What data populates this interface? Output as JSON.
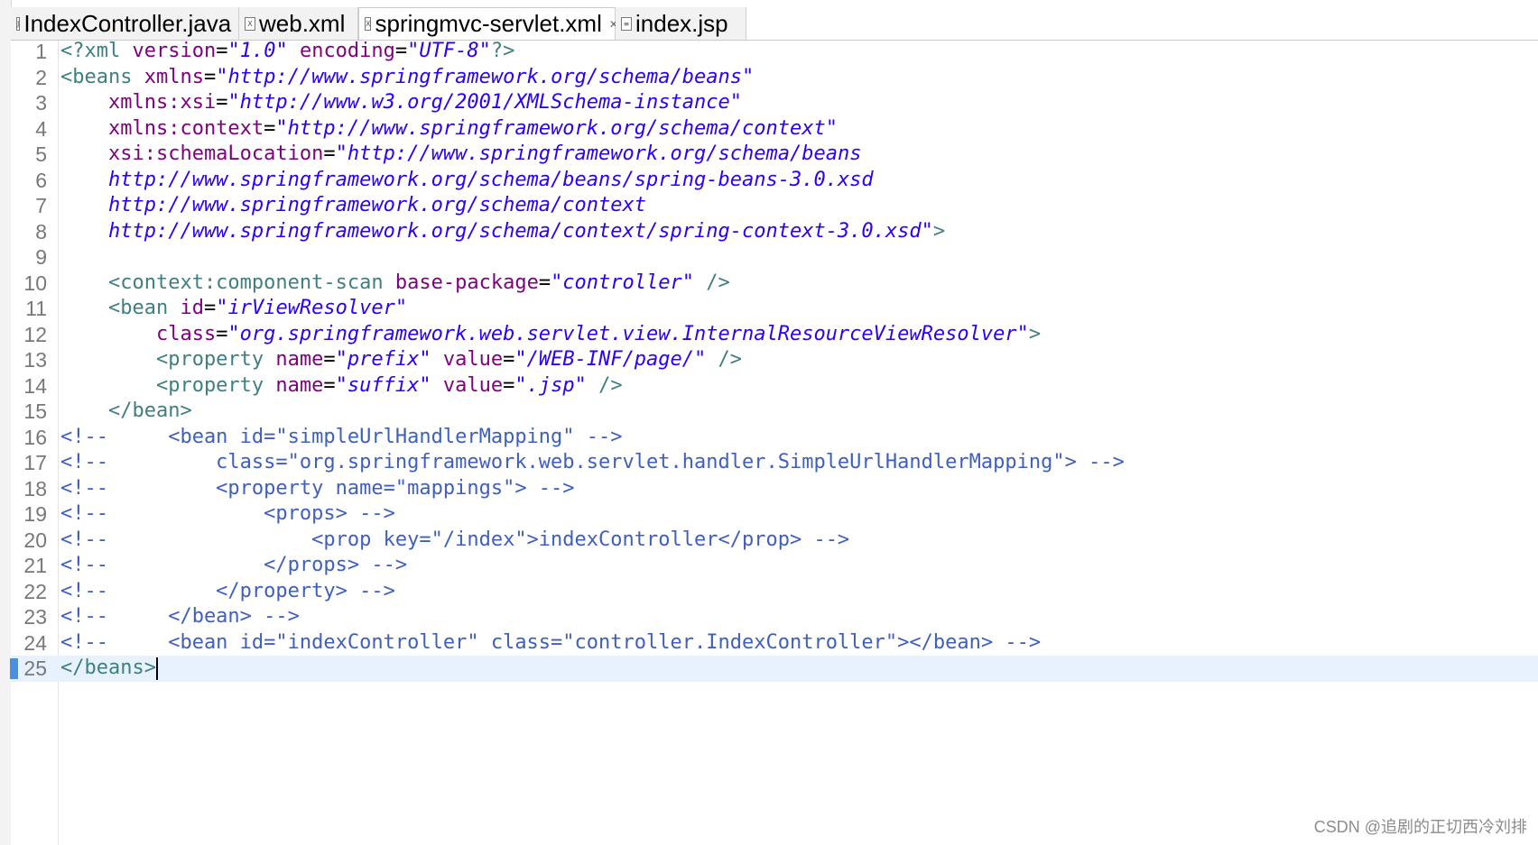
{
  "tabs": [
    {
      "label": "IndexController.java",
      "icon": "java-file-icon",
      "icon_glyph": "J",
      "active": false
    },
    {
      "label": "web.xml",
      "icon": "xml-file-icon",
      "icon_glyph": "X",
      "active": false
    },
    {
      "label": "springmvc-servlet.xml",
      "icon": "xml-file-icon",
      "icon_glyph": "X",
      "active": true,
      "close": "✕"
    },
    {
      "label": "index.jsp",
      "icon": "jsp-file-icon",
      "icon_glyph": "≡",
      "active": false
    }
  ],
  "colors": {
    "tag": "#3f7f7f",
    "attr": "#7f007f",
    "string": "#2a00ff",
    "comment": "#3f5fbf",
    "punct": "#008080",
    "text": "#000000"
  },
  "lines": [
    {
      "n": "1",
      "tokens": [
        {
          "t": "<?",
          "c": "tag"
        },
        {
          "t": "xml",
          "c": "tag"
        },
        {
          "t": " version",
          "c": "attr"
        },
        {
          "t": "=",
          "c": "text"
        },
        {
          "t": "\"1.0\"",
          "c": "string",
          "i": true
        },
        {
          "t": " encoding",
          "c": "attr"
        },
        {
          "t": "=",
          "c": "text"
        },
        {
          "t": "\"UTF-8\"",
          "c": "string",
          "i": true
        },
        {
          "t": "?>",
          "c": "tag"
        }
      ]
    },
    {
      "n": "2",
      "tokens": [
        {
          "t": "<beans",
          "c": "tag"
        },
        {
          "t": " xmlns",
          "c": "attr"
        },
        {
          "t": "=",
          "c": "text"
        },
        {
          "t": "\"http://www.springframework.org/schema/beans\"",
          "c": "string",
          "i": true
        }
      ]
    },
    {
      "n": "3",
      "tokens": [
        {
          "t": "    xmlns:xsi",
          "c": "attr"
        },
        {
          "t": "=",
          "c": "text"
        },
        {
          "t": "\"http://www.w3.org/2001/XMLSchema-instance\"",
          "c": "string",
          "i": true
        }
      ]
    },
    {
      "n": "4",
      "tokens": [
        {
          "t": "    xmlns:context",
          "c": "attr"
        },
        {
          "t": "=",
          "c": "text"
        },
        {
          "t": "\"http://www.springframework.org/schema/context\"",
          "c": "string",
          "i": true
        }
      ]
    },
    {
      "n": "5",
      "tokens": [
        {
          "t": "    xsi:schemaLocation",
          "c": "attr"
        },
        {
          "t": "=",
          "c": "text"
        },
        {
          "t": "\"http://www.springframework.org/schema/beans",
          "c": "string",
          "i": true
        }
      ]
    },
    {
      "n": "6",
      "tokens": [
        {
          "t": "    http://www.springframework.org/schema/beans/spring-beans-3.0.xsd",
          "c": "string",
          "i": true
        }
      ]
    },
    {
      "n": "7",
      "tokens": [
        {
          "t": "    http://www.springframework.org/schema/context",
          "c": "string",
          "i": true
        }
      ]
    },
    {
      "n": "8",
      "tokens": [
        {
          "t": "    http://www.springframework.org/schema/context/spring-context-3.0.xsd\"",
          "c": "string",
          "i": true
        },
        {
          "t": ">",
          "c": "tag"
        }
      ]
    },
    {
      "n": "9",
      "tokens": []
    },
    {
      "n": "10",
      "tokens": [
        {
          "t": "    <context:component-scan",
          "c": "tag"
        },
        {
          "t": " base-package",
          "c": "attr"
        },
        {
          "t": "=",
          "c": "text"
        },
        {
          "t": "\"controller\"",
          "c": "string",
          "i": true
        },
        {
          "t": " />",
          "c": "tag"
        }
      ]
    },
    {
      "n": "11",
      "tokens": [
        {
          "t": "    <bean",
          "c": "tag"
        },
        {
          "t": " id",
          "c": "attr"
        },
        {
          "t": "=",
          "c": "text"
        },
        {
          "t": "\"irViewResolver\"",
          "c": "string",
          "i": true
        }
      ]
    },
    {
      "n": "12",
      "tokens": [
        {
          "t": "        class",
          "c": "attr"
        },
        {
          "t": "=",
          "c": "text"
        },
        {
          "t": "\"org.springframework.web.servlet.view.InternalResourceViewResolver\"",
          "c": "string",
          "i": true
        },
        {
          "t": ">",
          "c": "tag"
        }
      ]
    },
    {
      "n": "13",
      "tokens": [
        {
          "t": "        <property",
          "c": "tag"
        },
        {
          "t": " name",
          "c": "attr"
        },
        {
          "t": "=",
          "c": "text"
        },
        {
          "t": "\"prefix\"",
          "c": "string",
          "i": true
        },
        {
          "t": " value",
          "c": "attr"
        },
        {
          "t": "=",
          "c": "text"
        },
        {
          "t": "\"/WEB-INF/page/\"",
          "c": "string",
          "i": true
        },
        {
          "t": " />",
          "c": "tag"
        }
      ]
    },
    {
      "n": "14",
      "tokens": [
        {
          "t": "        <property",
          "c": "tag"
        },
        {
          "t": " name",
          "c": "attr"
        },
        {
          "t": "=",
          "c": "text"
        },
        {
          "t": "\"suffix\"",
          "c": "string",
          "i": true
        },
        {
          "t": " value",
          "c": "attr"
        },
        {
          "t": "=",
          "c": "text"
        },
        {
          "t": "\".jsp\"",
          "c": "string",
          "i": true
        },
        {
          "t": " />",
          "c": "tag"
        }
      ]
    },
    {
      "n": "15",
      "tokens": [
        {
          "t": "    </bean>",
          "c": "tag"
        }
      ]
    },
    {
      "n": "16",
      "tokens": [
        {
          "t": "<!--     <bean id=\"simpleUrlHandlerMapping\" -->",
          "c": "comment"
        }
      ]
    },
    {
      "n": "17",
      "tokens": [
        {
          "t": "<!--         class=\"org.springframework.web.servlet.handler.SimpleUrlHandlerMapping\"> -->",
          "c": "comment"
        }
      ]
    },
    {
      "n": "18",
      "tokens": [
        {
          "t": "<!--         <property name=\"mappings\"> -->",
          "c": "comment"
        }
      ]
    },
    {
      "n": "19",
      "tokens": [
        {
          "t": "<!--             <props> -->",
          "c": "comment"
        }
      ]
    },
    {
      "n": "20",
      "tokens": [
        {
          "t": "<!--                 <prop key=\"/index\">indexController</prop> -->",
          "c": "comment"
        }
      ]
    },
    {
      "n": "21",
      "tokens": [
        {
          "t": "<!--             </props> -->",
          "c": "comment"
        }
      ]
    },
    {
      "n": "22",
      "tokens": [
        {
          "t": "<!--         </property> -->",
          "c": "comment"
        }
      ]
    },
    {
      "n": "23",
      "tokens": [
        {
          "t": "<!--     </bean> -->",
          "c": "comment"
        }
      ]
    },
    {
      "n": "24",
      "tokens": [
        {
          "t": "<!--     <bean id=\"indexController\" class=\"controller.IndexController\"></bean> -->",
          "c": "comment"
        }
      ]
    },
    {
      "n": "25",
      "tokens": [
        {
          "t": "</beans>",
          "c": "tag"
        }
      ],
      "current": true
    }
  ],
  "watermark": "CSDN @追剧的正切西冷刘排"
}
